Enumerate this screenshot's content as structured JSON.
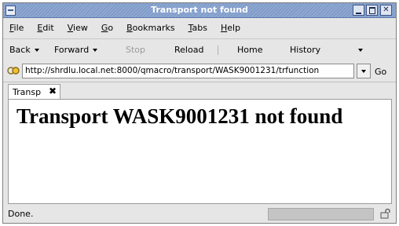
{
  "window": {
    "title": "Transport not found"
  },
  "menubar": {
    "items": [
      {
        "label": "File",
        "acc": "F",
        "rest": "ile"
      },
      {
        "label": "Edit",
        "acc": "E",
        "rest": "dit"
      },
      {
        "label": "View",
        "acc": "V",
        "rest": "iew"
      },
      {
        "label": "Go",
        "acc": "G",
        "rest": "o"
      },
      {
        "label": "Bookmarks",
        "acc": "B",
        "rest": "ookmarks"
      },
      {
        "label": "Tabs",
        "acc": "T",
        "rest": "abs"
      },
      {
        "label": "Help",
        "acc": "H",
        "rest": "elp"
      }
    ]
  },
  "toolbar": {
    "back_label": "Back",
    "forward_label": "Forward",
    "stop_label": "Stop",
    "reload_label": "Reload",
    "home_label": "Home",
    "history_label": "History"
  },
  "urlbar": {
    "value": "http://shrdlu.local.net:8000/qmacro/transport/WASK9001231/trfunction",
    "go_label": "Go"
  },
  "tabs": [
    {
      "label": "Transp",
      "close_glyph": "✖"
    }
  ],
  "page": {
    "heading": "Transport WASK9001231 not found"
  },
  "statusbar": {
    "text": "Done."
  },
  "colors": {
    "titlebar": "#7a96c4",
    "chrome": "#e6e6e6",
    "content_bg": "#ffffff"
  },
  "icons": {
    "url_icon": "site-icon",
    "security_icon": "security-icon"
  }
}
